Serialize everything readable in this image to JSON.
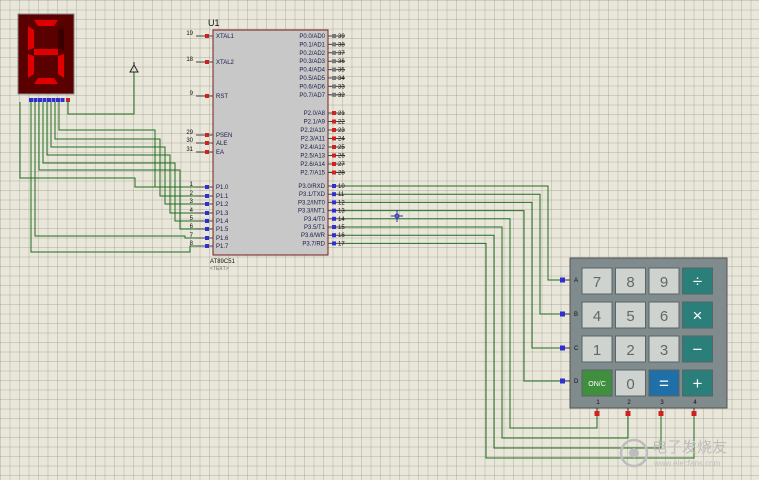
{
  "display": {
    "digit": "6",
    "segment_color": "#e00000",
    "body_color": "#5a0000"
  },
  "chip": {
    "ref": "U1",
    "name": "AT89C51",
    "text_placeholder": "<TEXT>",
    "left_pins": [
      {
        "num": "19",
        "label": "XTAL1"
      },
      {
        "num": "18",
        "label": "XTAL2"
      },
      {
        "num": "9",
        "label": "RST"
      },
      {
        "num": "29",
        "label": "PSEN"
      },
      {
        "num": "30",
        "label": "ALE"
      },
      {
        "num": "31",
        "label": "EA"
      },
      {
        "num": "1",
        "label": "P1.0"
      },
      {
        "num": "2",
        "label": "P1.1"
      },
      {
        "num": "3",
        "label": "P1.2"
      },
      {
        "num": "4",
        "label": "P1.3"
      },
      {
        "num": "5",
        "label": "P1.4"
      },
      {
        "num": "6",
        "label": "P1.5"
      },
      {
        "num": "7",
        "label": "P1.6"
      },
      {
        "num": "8",
        "label": "P1.7"
      }
    ],
    "right_pins": [
      {
        "num": "39",
        "label": "P0.0/AD0"
      },
      {
        "num": "38",
        "label": "P0.1/AD1"
      },
      {
        "num": "37",
        "label": "P0.2/AD2"
      },
      {
        "num": "36",
        "label": "P0.3/AD3"
      },
      {
        "num": "35",
        "label": "P0.4/AD4"
      },
      {
        "num": "34",
        "label": "P0.5/AD5"
      },
      {
        "num": "33",
        "label": "P0.6/AD6"
      },
      {
        "num": "32",
        "label": "P0.7/AD7"
      },
      {
        "num": "21",
        "label": "P2.0/A8"
      },
      {
        "num": "22",
        "label": "P2.1/A9"
      },
      {
        "num": "23",
        "label": "P2.2/A10"
      },
      {
        "num": "24",
        "label": "P2.3/A11"
      },
      {
        "num": "25",
        "label": "P2.4/A12"
      },
      {
        "num": "26",
        "label": "P2.5/A13"
      },
      {
        "num": "27",
        "label": "P2.6/A14"
      },
      {
        "num": "28",
        "label": "P2.7/A15"
      },
      {
        "num": "10",
        "label": "P3.0/RXD"
      },
      {
        "num": "11",
        "label": "P3.1/TXD"
      },
      {
        "num": "12",
        "label": "P3.2/INT0"
      },
      {
        "num": "13",
        "label": "P3.3/INT1"
      },
      {
        "num": "14",
        "label": "P3.4/T0"
      },
      {
        "num": "15",
        "label": "P3.5/T1"
      },
      {
        "num": "16",
        "label": "P3.6/WR"
      },
      {
        "num": "17",
        "label": "P3.7/RD"
      }
    ]
  },
  "keypad": {
    "rows": [
      "A",
      "B",
      "C",
      "D"
    ],
    "cols": [
      "1",
      "2",
      "3",
      "4"
    ],
    "keys": [
      [
        "7",
        "8",
        "9",
        "÷"
      ],
      [
        "4",
        "5",
        "6",
        "×"
      ],
      [
        "1",
        "2",
        "3",
        "−"
      ],
      [
        "ON/C",
        "0",
        "=",
        "+"
      ]
    ]
  },
  "watermark": {
    "text": "电子发烧友",
    "url": "www.elecfans.com"
  },
  "colors": {
    "wire": "#1f6d1f",
    "pin_red": "#d02020",
    "pin_blue": "#3030d0",
    "chip_fill": "#c8c8c8",
    "chip_border": "#7a1d1d",
    "keypad_body": "#7f8b8c",
    "key_light": "#cfd3d0",
    "key_teal": "#2a7f7a",
    "key_blue": "#1f6fa8",
    "key_green": "#3f8f3f"
  }
}
